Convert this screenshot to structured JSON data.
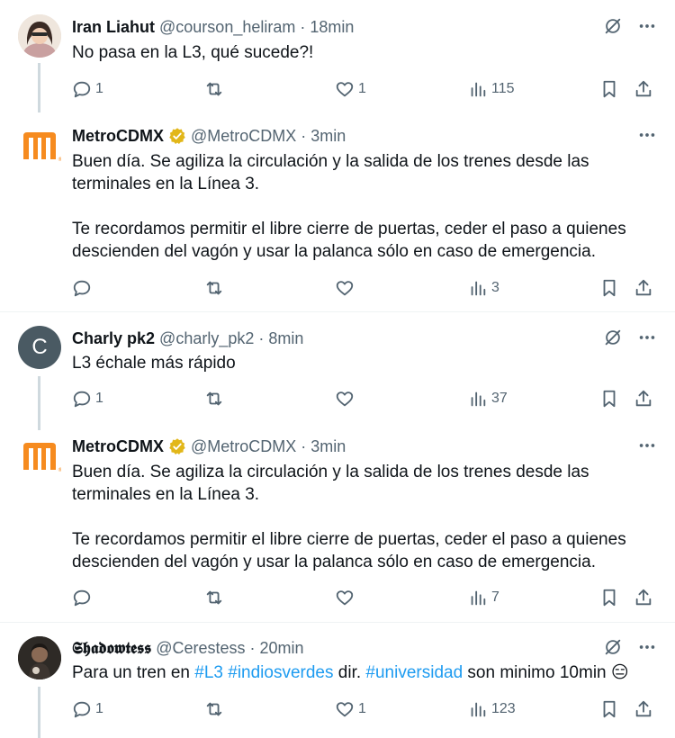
{
  "colors": {
    "text": "#0f1419",
    "secondary": "#536471",
    "link": "#1d9bf0",
    "border": "#eff3f4",
    "thread_line": "#cfd9de",
    "verified_gold": "#e2b719",
    "metro_orange": "#f68b1f"
  },
  "tweets": [
    {
      "name": "Iran Liahut",
      "handle": "@courson_heliram",
      "separator": "·",
      "time": "18min",
      "text": "No pasa en la L3, qué sucede?!",
      "stats": {
        "replies": "1",
        "retweets": "",
        "likes": "1",
        "views": "115"
      }
    },
    {
      "name": "MetroCDMX",
      "handle": "@MetroCDMX",
      "separator": "·",
      "time": "3min",
      "verified": true,
      "text": "Buen día. Se agiliza la circulación y la salida de los trenes desde las terminales en la Línea 3.\n\nTe recordamos permitir el libre cierre de puertas, ceder el paso a quienes descienden del vagón y usar la palanca sólo en caso de emergencia.",
      "stats": {
        "replies": "",
        "retweets": "",
        "likes": "",
        "views": "3"
      }
    },
    {
      "name": "Charly pk2",
      "handle": "@charly_pk2",
      "separator": "·",
      "time": "8min",
      "avatar_letter": "C",
      "text": "L3 échale más rápido",
      "stats": {
        "replies": "1",
        "retweets": "",
        "likes": "",
        "views": "37"
      }
    },
    {
      "name": "MetroCDMX",
      "handle": "@MetroCDMX",
      "separator": "·",
      "time": "3min",
      "verified": true,
      "text": "Buen día. Se agiliza la circulación y la salida de los trenes desde las terminales en la Línea 3.\n\nTe recordamos permitir el libre cierre de puertas, ceder el paso a quienes descienden del vagón y usar la palanca sólo en caso de emergencia.",
      "stats": {
        "replies": "",
        "retweets": "",
        "likes": "",
        "views": "7"
      }
    },
    {
      "name": "𝕾𝖍𝖆𝖉𝖔𝖜𝖙𝖊𝖘𝖘",
      "handle": "@Cerestess",
      "separator": "·",
      "time": "20min",
      "text_parts": {
        "p1": "Para un tren en ",
        "h1": "#L3",
        "sp": " ",
        "h2": "#indiosverdes",
        "p2": " dir. ",
        "h3": "#universidad",
        "p3": " son minimo 10min ",
        "emoji": "😑"
      },
      "stats": {
        "replies": "1",
        "retweets": "",
        "likes": "1",
        "views": "123"
      }
    }
  ],
  "icons": [
    "grok-icon",
    "more-icon",
    "reply-icon",
    "retweet-icon",
    "like-icon",
    "views-icon",
    "bookmark-icon",
    "share-icon",
    "verified-badge-icon",
    "metro-logo-icon"
  ]
}
